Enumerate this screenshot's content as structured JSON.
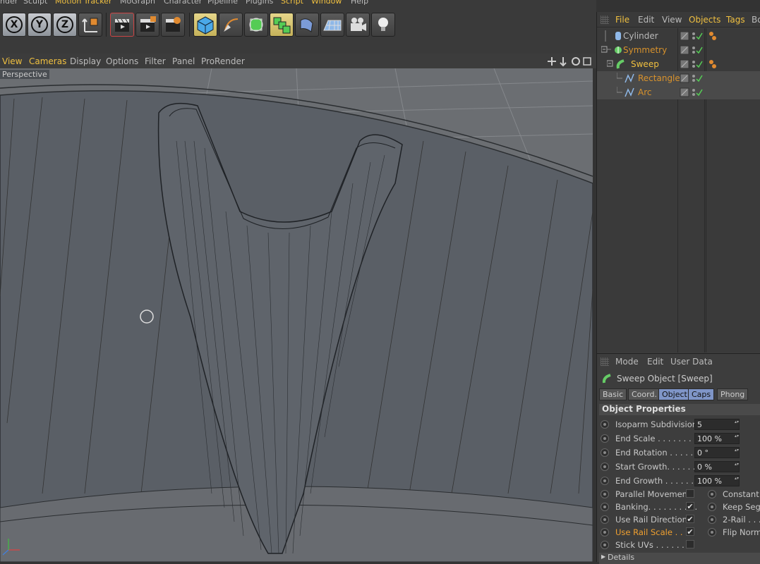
{
  "main_menu": [
    {
      "label": "nder",
      "hl": false
    },
    {
      "label": "Sculpt",
      "hl": false
    },
    {
      "label": "Motion Tracker",
      "hl": true
    },
    {
      "label": "MoGraph",
      "hl": false
    },
    {
      "label": "Character",
      "hl": false
    },
    {
      "label": "Pipeline",
      "hl": false
    },
    {
      "label": "Plugins",
      "hl": false
    },
    {
      "label": "Script",
      "hl": true
    },
    {
      "label": "Window",
      "hl": true
    },
    {
      "label": "Help",
      "hl": false
    }
  ],
  "axis_buttons": [
    "X",
    "Y",
    "Z"
  ],
  "viewport_menu": [
    {
      "label": "View",
      "hl": true
    },
    {
      "label": "Cameras",
      "hl": true
    },
    {
      "label": "Display",
      "hl": false
    },
    {
      "label": "Options",
      "hl": false
    },
    {
      "label": "Filter",
      "hl": false
    },
    {
      "label": "Panel",
      "hl": false
    },
    {
      "label": "ProRender",
      "hl": false
    }
  ],
  "viewport_label": "Perspective",
  "object_menu": [
    {
      "label": "File",
      "hl": true
    },
    {
      "label": "Edit",
      "hl": false
    },
    {
      "label": "View",
      "hl": false
    },
    {
      "label": "Objects",
      "hl": true
    },
    {
      "label": "Tags",
      "hl": true
    },
    {
      "label": "Bo",
      "hl": false
    }
  ],
  "objects": [
    {
      "name": "Cylinder",
      "color": "#b9b9b9",
      "icon": "cylinder-icon",
      "indent": 0
    },
    {
      "name": "Symmetry",
      "color": "#d8922c",
      "icon": "symmetry-icon",
      "indent": 0
    },
    {
      "name": "Sweep",
      "color": "#f0c040",
      "icon": "sweep-icon",
      "indent": 1
    },
    {
      "name": "Rectangle",
      "color": "#d8922c",
      "icon": "spline-icon",
      "indent": 2
    },
    {
      "name": "Arc",
      "color": "#d8922c",
      "icon": "spline-icon",
      "indent": 2
    }
  ],
  "attr_menu": [
    "Mode",
    "Edit",
    "User Data"
  ],
  "attr_title": "Sweep Object [Sweep]",
  "tabs": [
    {
      "label": "Basic",
      "on": false
    },
    {
      "label": "Coord.",
      "on": false
    },
    {
      "label": "Object",
      "on": true
    },
    {
      "label": "Caps",
      "on": true
    },
    {
      "label": "Phong",
      "on": false
    }
  ],
  "section_title": "Object Properties",
  "fields": [
    {
      "label": "Isoparm Subdivision",
      "value": "5"
    },
    {
      "label": "End Scale . . . . . . . . .",
      "value": "100 %"
    },
    {
      "label": "End Rotation . . . . . .",
      "value": "0 °"
    },
    {
      "label": "Start Growth. . . . . . .",
      "value": "0 %"
    },
    {
      "label": "End Growth . . . . . . .",
      "value": "100 %"
    }
  ],
  "checks_left": [
    {
      "label": "Parallel Movement",
      "checked": false,
      "hl": false
    },
    {
      "label": "Banking. . . . . . . . . .",
      "checked": true,
      "hl": false
    },
    {
      "label": "Use Rail Direction",
      "checked": true,
      "hl": false
    },
    {
      "label": "Use Rail Scale . . .",
      "checked": true,
      "hl": true
    },
    {
      "label": "Stick UVs . . . . . . . .",
      "checked": false,
      "hl": false
    }
  ],
  "checks_right": [
    "Constant C",
    "Keep Segm",
    "2-Rail . . .",
    "Flip Norma"
  ],
  "details_label": "Details",
  "colors": {
    "accent": "#f0c040",
    "tab_active": "#7f95c7",
    "viewport": "#5a5e63"
  }
}
